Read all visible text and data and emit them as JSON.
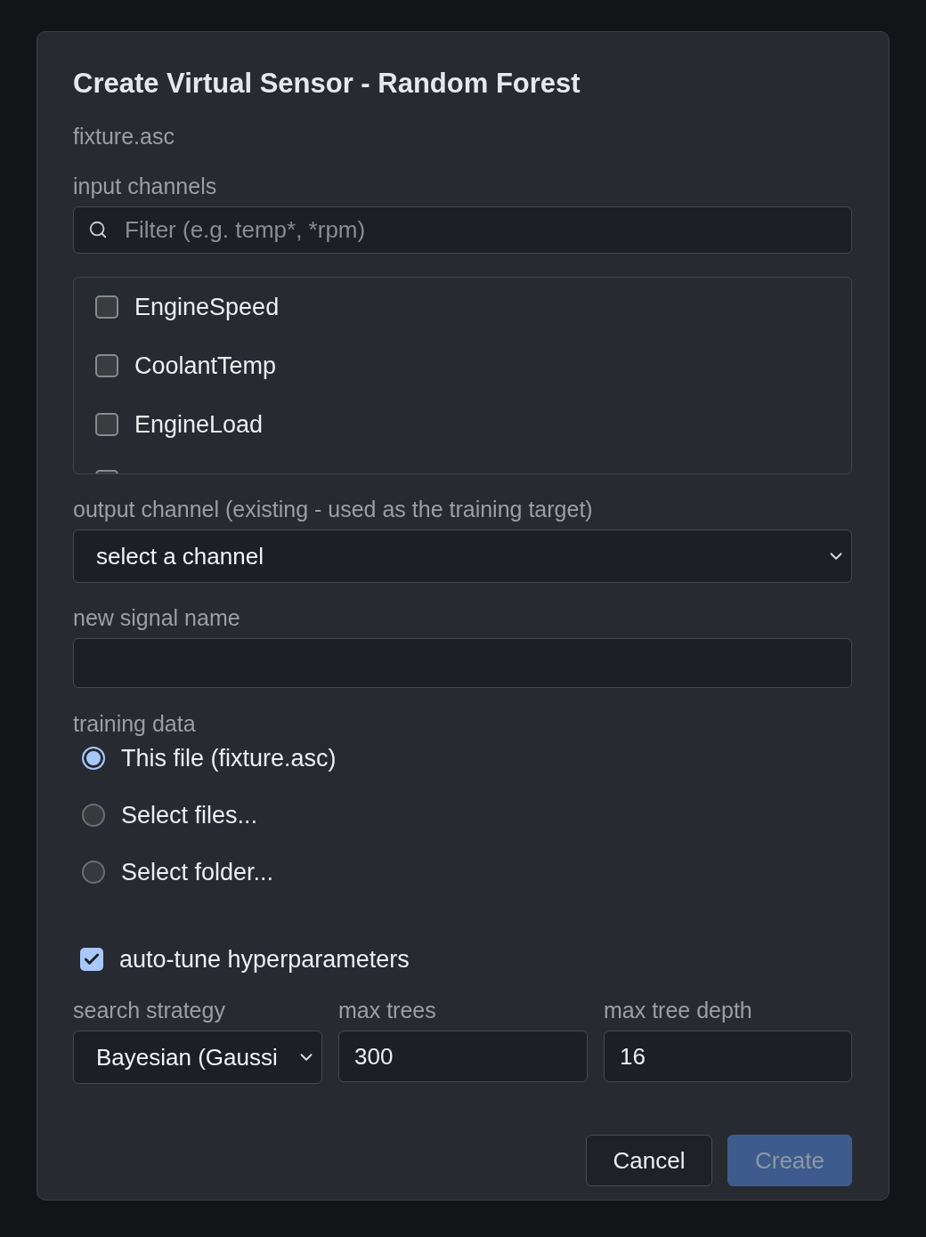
{
  "dialog": {
    "title": "Create Virtual Sensor - Random Forest",
    "file_name": "fixture.asc"
  },
  "input_channels": {
    "label": "input channels",
    "filter": {
      "placeholder": "Filter (e.g. temp*, *rpm)"
    },
    "items": [
      {
        "label": "EngineSpeed",
        "checked": false
      },
      {
        "label": "CoolantTemp",
        "checked": false
      },
      {
        "label": "EngineLoad",
        "checked": false
      },
      {
        "checked": false
      }
    ]
  },
  "output_channel": {
    "label": "output channel (existing - used as the training target)",
    "value": "select a channel"
  },
  "new_signal_name": {
    "label": "new signal name"
  },
  "training_data": {
    "label": "training data",
    "options": [
      {
        "label": "This file (fixture.asc)",
        "selected": true
      },
      {
        "label": "Select files...",
        "selected": false
      },
      {
        "label": "Select folder...",
        "selected": false
      }
    ]
  },
  "auto_tune": {
    "label": "auto-tune hyperparameters",
    "checked": true
  },
  "parameters": [
    {
      "label": "search strategy",
      "kind": "select",
      "value": "Bayesian (Gaussi"
    },
    {
      "label": "max trees",
      "kind": "input",
      "value": "300"
    },
    {
      "label": "max tree depth",
      "kind": "input",
      "value": "16"
    }
  ],
  "buttons": [
    {
      "label": "Cancel",
      "kind": "secondary",
      "disabled": false
    },
    {
      "label": "Create",
      "kind": "primary",
      "disabled": true
    }
  ]
}
